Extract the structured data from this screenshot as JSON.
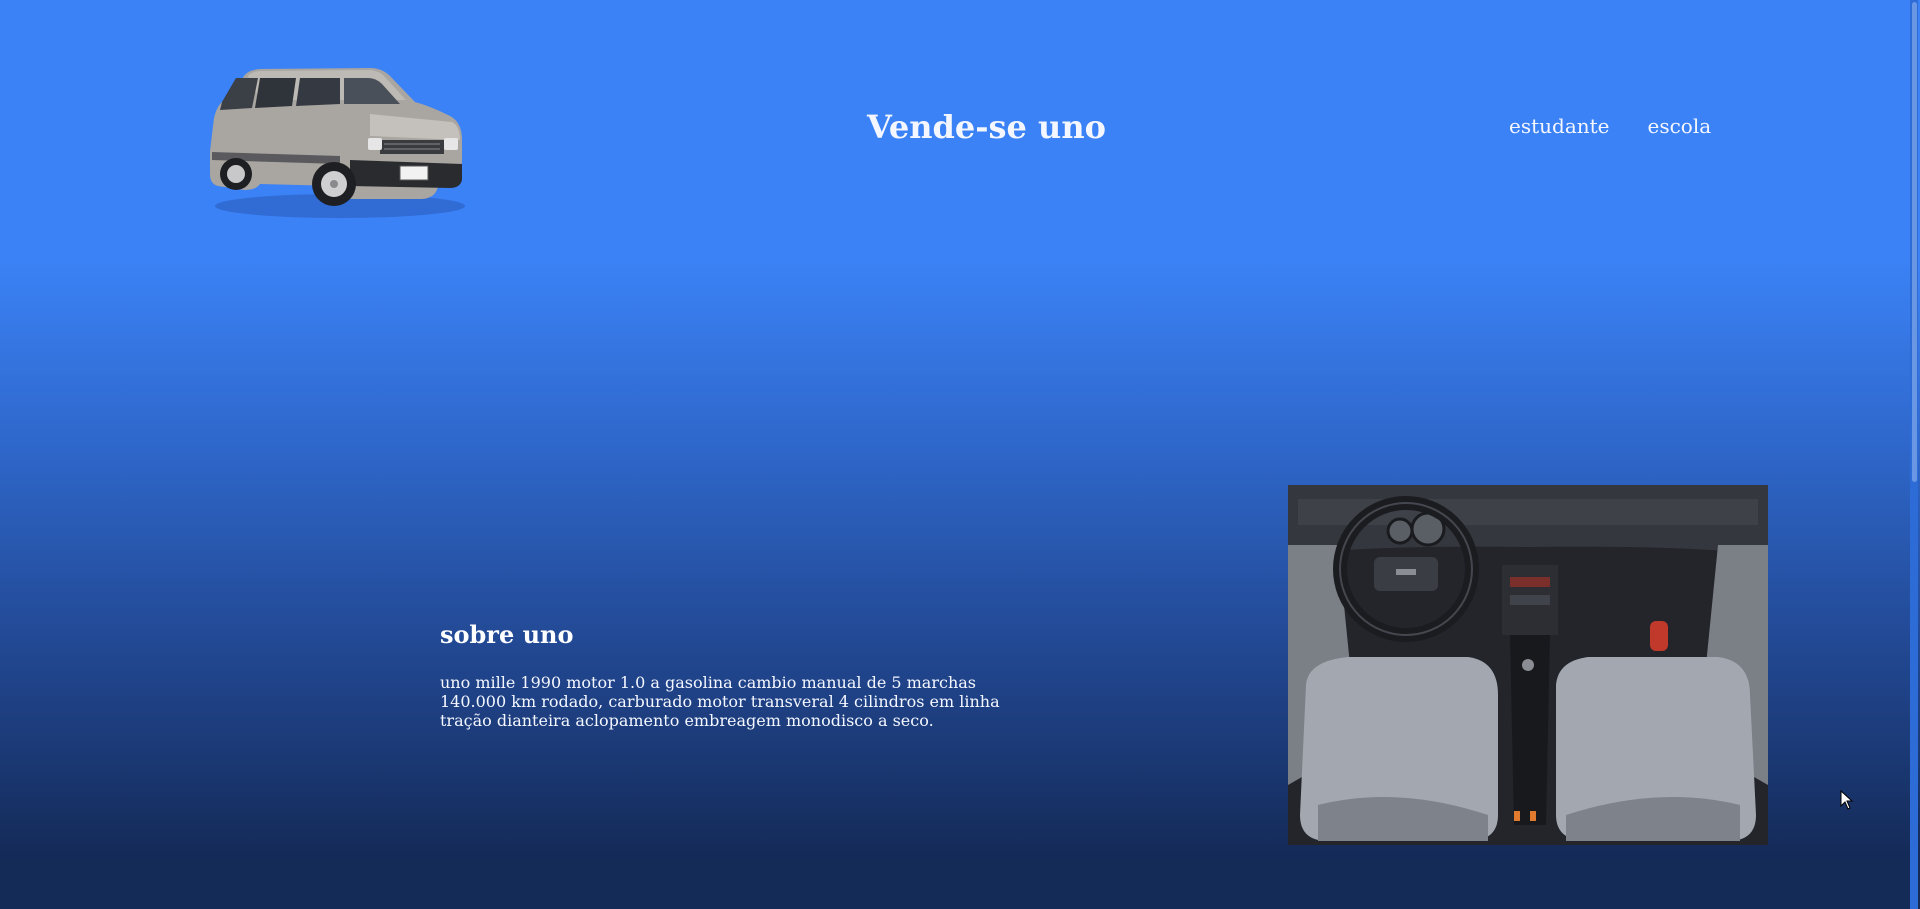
{
  "header": {
    "title": "Vende-se uno",
    "logo_icon": "car-exterior-icon"
  },
  "nav": {
    "items": [
      {
        "label": "estudante"
      },
      {
        "label": "escola"
      }
    ]
  },
  "about": {
    "heading": "sobre uno",
    "lines": [
      "uno mille 1990 motor 1.0 a gasolina cambio manual de 5 marchas",
      "140.000 km rodado, carburado motor transveral 4 cilindros em linha",
      "tração dianteira aclopamento embreagem monodisco a seco."
    ]
  },
  "media": {
    "interior_image_icon": "car-interior-photo"
  },
  "colors": {
    "background_top": "#3b82f6",
    "background_bottom": "#142a57",
    "text": "#ffffff"
  }
}
